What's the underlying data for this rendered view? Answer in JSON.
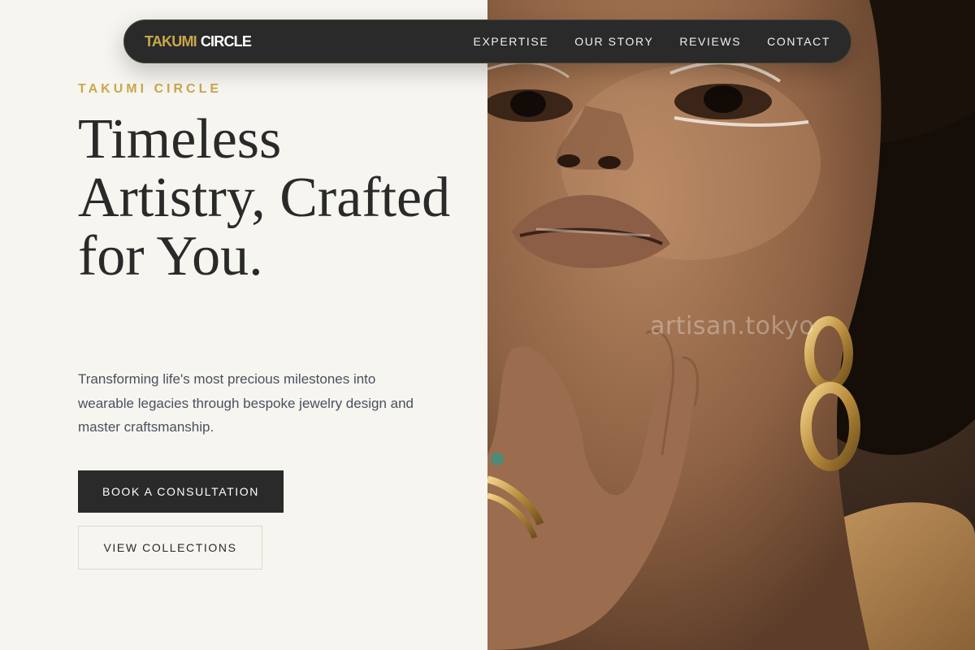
{
  "brand": {
    "part1": "TAKUMI",
    "part2": "CIRCLE"
  },
  "nav": {
    "items": [
      {
        "label": "EXPERTISE"
      },
      {
        "label": "OUR STORY"
      },
      {
        "label": "REVIEWS"
      },
      {
        "label": "CONTACT"
      }
    ]
  },
  "hero": {
    "eyebrow": "TAKUMI CIRCLE",
    "headline": "Timeless Artistry, Crafted for You.",
    "description": "Transforming life's most precious milestones into wearable legacies through bespoke jewelry design and master craftsmanship.",
    "primary_button": "BOOK A CONSULTATION",
    "secondary_button": "VIEW COLLECTIONS"
  },
  "image": {
    "watermark": "artisan.tokyo"
  },
  "colors": {
    "accent_gold": "#c9a84a",
    "dark": "#2a2a2a",
    "background": "#f7f5f0"
  }
}
